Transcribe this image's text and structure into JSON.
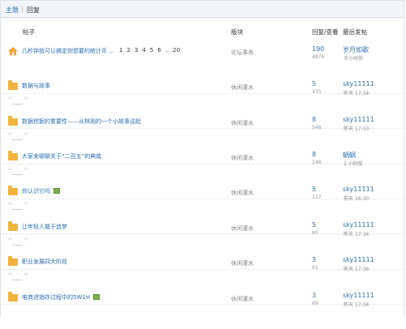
{
  "breadcrumb": {
    "home": "主题",
    "separator": "|",
    "current": "回复"
  },
  "columns": {
    "post": "帖子",
    "forum": "版块",
    "stats": "回复/查看",
    "last": "最后发帖"
  },
  "threads": [
    {
      "icon": "home-icon",
      "title": "几秒钟就可以搞定你想要的统计币 ...",
      "pages": [
        "1",
        "2",
        "3",
        "4",
        "5",
        "6",
        "..",
        "20"
      ],
      "has_image": false,
      "forum": "论坛事务",
      "replies": "190",
      "views": "4878",
      "last_user": "岁月如歌",
      "last_time": "半小时前",
      "quote": ""
    },
    {
      "icon": "folder-icon",
      "title": "数据与故事",
      "pages": [],
      "has_image": false,
      "forum": "休闲灌水",
      "replies": "5",
      "views": "435",
      "last_user": "sky11111",
      "last_time": "昨天 17:34",
      "quote": "......"
    },
    {
      "icon": "folder-icon",
      "title": "数据挖掘的重要性——从林则的一个小故事谈起",
      "pages": [],
      "has_image": false,
      "forum": "休闲灌水",
      "replies": "8",
      "views": "548",
      "last_user": "sky11111",
      "last_time": "昨天 17:33",
      "quote": "......"
    },
    {
      "icon": "folder-icon",
      "title": "大家来聊聊关于“二百五”的典故",
      "pages": [],
      "has_image": false,
      "forum": "休闲灌水",
      "replies": "8",
      "views": "148",
      "last_user": "蜗蜗",
      "last_time": "2 小时前",
      "quote": "......"
    },
    {
      "icon": "folder-icon",
      "title": "你认识它吗",
      "pages": [],
      "has_image": true,
      "forum": "休闲灌水",
      "replies": "5",
      "views": "117",
      "last_user": "sky11111",
      "last_time": "前天 16:30",
      "quote": "......"
    },
    {
      "icon": "folder-icon",
      "title": "让年轻人敢于追梦",
      "pages": [],
      "has_image": false,
      "forum": "休闲灌水",
      "replies": "5",
      "views": "80",
      "last_user": "sky11111",
      "last_time": "昨天 17:34",
      "quote": "......"
    },
    {
      "icon": "folder-icon",
      "title": "职业发展四大阶段",
      "pages": [],
      "has_image": false,
      "forum": "休闲灌水",
      "replies": "3",
      "views": "61",
      "last_user": "sky11111",
      "last_time": "昨天 17:36",
      "quote": "......"
    },
    {
      "icon": "folder-icon",
      "title": "电商进销存过程中的5W1H",
      "pages": [],
      "has_image": true,
      "forum": "休闲灌水",
      "replies": "3",
      "views": "69",
      "last_user": "sky11111",
      "last_time": "昨天 17:34",
      "quote": ""
    }
  ]
}
